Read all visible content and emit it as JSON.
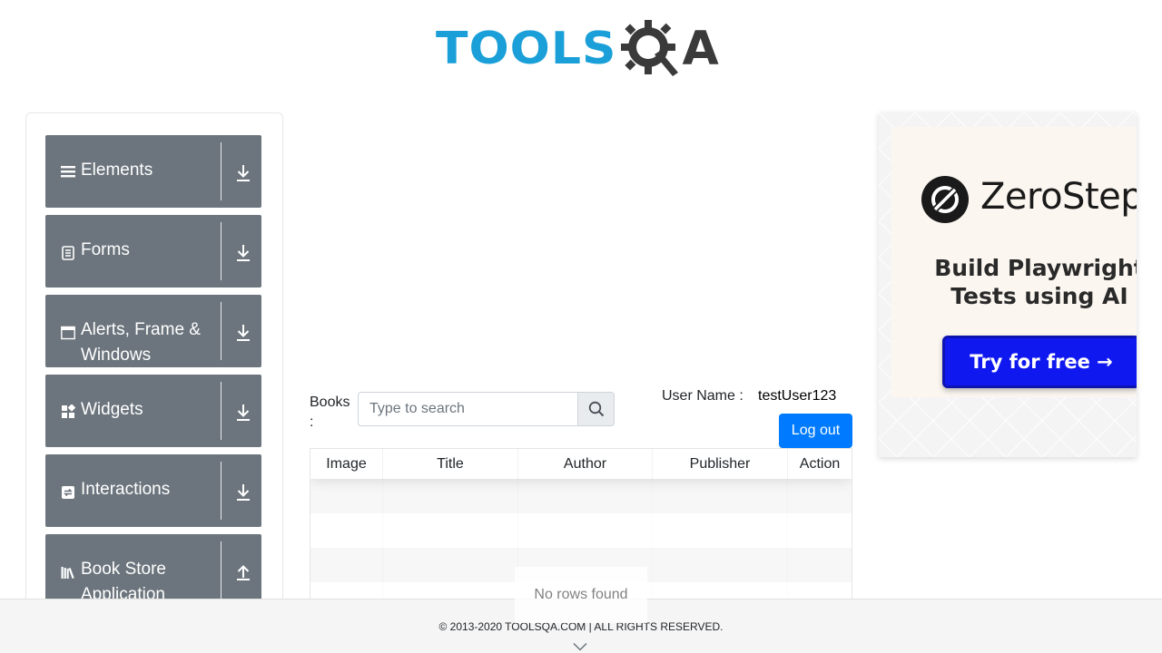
{
  "header": {
    "logo_tools": "TOOLS",
    "logo_qa": "A",
    "logo_icon": "gear-q-icon",
    "colors": {
      "tools": "#1a9fd8",
      "qa": "#3a3a3a"
    }
  },
  "sidebar": {
    "groups": [
      {
        "label": "Elements",
        "icon": "hamburger-icon",
        "toggle": "download-arrow-icon"
      },
      {
        "label": "Forms",
        "icon": "form-doc-icon",
        "toggle": "download-arrow-icon"
      },
      {
        "label": "Alerts, Frame & Windows",
        "icon": "window-icon",
        "toggle": "download-arrow-icon"
      },
      {
        "label": "Widgets",
        "icon": "widgets-icon",
        "toggle": "download-arrow-icon"
      },
      {
        "label": "Interactions",
        "icon": "interactions-icon",
        "toggle": "download-arrow-icon"
      },
      {
        "label": "Book Store Application",
        "icon": "bookshelf-icon",
        "toggle": "upload-arrow-icon"
      }
    ],
    "colors": {
      "group_bg": "#6c757d",
      "text": "#ffffff"
    }
  },
  "main": {
    "books_label": "Books :",
    "search": {
      "placeholder": "Type to search",
      "value": ""
    },
    "user": {
      "label": "User Name :",
      "value": "testUser123"
    },
    "logout_label": "Log out",
    "table": {
      "columns": [
        "Image",
        "Title",
        "Author",
        "Publisher",
        "Action"
      ],
      "rows": [],
      "empty_text": "No rows found"
    },
    "colors": {
      "primary": "#007bff"
    }
  },
  "ad": {
    "brand": "ZeroStep",
    "headline": "Build Playwright Tests using AI",
    "cta": "Try for free →",
    "colors": {
      "cta": "#1018f0",
      "card": "#fbf6f0"
    }
  },
  "footer": {
    "copyright": "© 2013-2020 TOOLSQA.COM | ALL RIGHTS RESERVED."
  }
}
